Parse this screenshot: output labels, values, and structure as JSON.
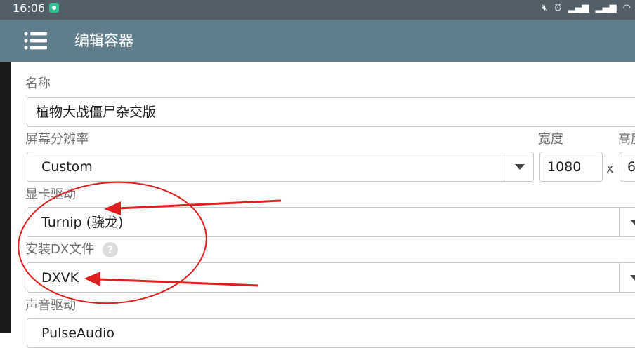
{
  "statusbar": {
    "time": "16:06",
    "icons": [
      "mute-icon",
      "alarm-icon",
      "signal-icon",
      "signal-icon",
      "wifi-icon"
    ]
  },
  "toolbar": {
    "title": "编辑容器",
    "menu_icon": "menu-list-icon"
  },
  "form": {
    "name_label": "名称",
    "name_value": "植物大战僵尸杂交版",
    "resolution_label": "屏幕分辨率",
    "resolution_value": "Custom",
    "width_label": "宽度",
    "width_value": "1080",
    "height_label": "高度",
    "height_value": "6",
    "times_sign": "x",
    "gpu_driver_label": "显卡驱动",
    "gpu_driver_value": "Turnip (骁龙)",
    "dx_label": "安装DX文件",
    "dx_help": "?",
    "dx_value": "DXVK",
    "audio_driver_label": "声音驱动",
    "audio_driver_value": "PulseAudio"
  },
  "annotation": {
    "color": "#e02020"
  }
}
